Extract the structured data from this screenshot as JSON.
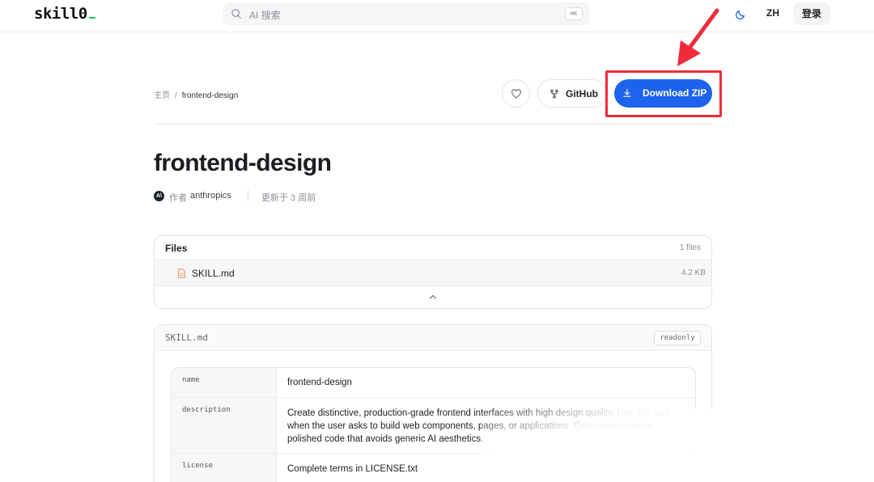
{
  "header": {
    "logo": "skill0",
    "search_placeholder": "AI 搜索",
    "search_shortcut": "⌘K",
    "lang_label": "ZH",
    "login_label": "登录"
  },
  "breadcrumb": {
    "home": "主页",
    "separator": "/",
    "current": "frontend-design"
  },
  "actions": {
    "github_label": "GitHub",
    "download_label": "Download ZIP"
  },
  "skill": {
    "title": "frontend-design",
    "author_prefix": "作者",
    "author": "anthropics",
    "updated": "更新于 3 周前"
  },
  "files": {
    "heading": "Files",
    "count": "1 files",
    "items": [
      {
        "name": "SKILL.md",
        "size": "4.2 KB"
      }
    ]
  },
  "skill_md": {
    "filename": "SKILL.md",
    "mode_badge": "readonly",
    "frontmatter": [
      {
        "key": "name",
        "value": "frontend-design"
      },
      {
        "key": "description",
        "value": "Create distinctive, production-grade frontend interfaces with high design quality. Use this skill when the user asks to build web components, pages, or applications. Generates creative, polished code that avoids generic AI aesthetics."
      },
      {
        "key": "license",
        "value": "Complete terms in LICENSE.txt"
      }
    ]
  },
  "colors": {
    "accent": "#1d63ed",
    "highlight": "#ef2b3a",
    "logo_cursor": "#22c55e"
  }
}
